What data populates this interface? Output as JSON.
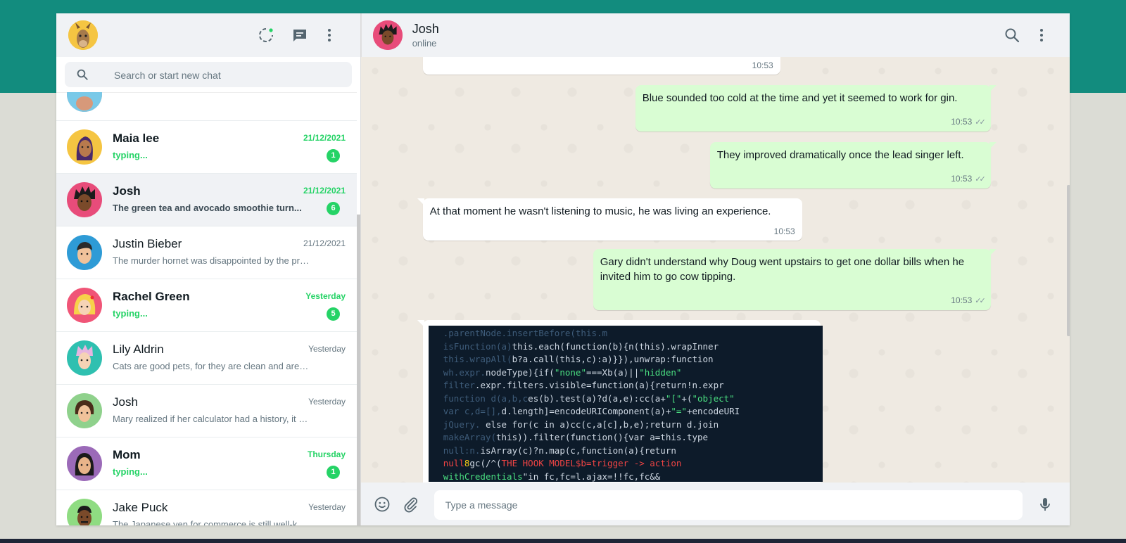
{
  "sidebar": {
    "search_placeholder": "Search or start new chat",
    "chats": [
      {
        "name": "",
        "time": "",
        "preview": "",
        "partial": true
      },
      {
        "name": "Maia lee",
        "time": "21/12/2021",
        "preview": "typing...",
        "unread": "1",
        "bold": true,
        "typing": true,
        "avatar_color": "#f5c542"
      },
      {
        "name": "Josh",
        "time": "21/12/2021",
        "preview": "The green tea and avocado smoothie turn...",
        "unread": "6",
        "bold": true,
        "active": true,
        "avatar_color": "#e84c7a"
      },
      {
        "name": "Justin Bieber",
        "time": "21/12/2021",
        "preview": "The murder hornet was disappointed by the prec...",
        "avatar_color": "#2e9bd6"
      },
      {
        "name": "Rachel Green",
        "time": "Yesterday",
        "preview": "typing...",
        "unread": "5",
        "bold": true,
        "typing": true,
        "avatar_color": "#f05577"
      },
      {
        "name": "Lily Aldrin",
        "time": "Yesterday",
        "preview": "Cats are good pets, for they are clean and are not...",
        "avatar_color": "#2fc0b0"
      },
      {
        "name": "Josh",
        "time": "Yesterday",
        "preview": "Mary realized if her calculator had a history, it wo...",
        "avatar_color": "#8fd18c"
      },
      {
        "name": "Mom",
        "time": "Thursday",
        "preview": "typing...",
        "unread": "1",
        "bold": true,
        "typing": true,
        "avatar_color": "#9b6ab8"
      },
      {
        "name": "Jake Puck",
        "time": "Yesterday",
        "preview": "The Japanese yen for commerce is still well-known.",
        "avatar_color": "#8fdc82"
      }
    ]
  },
  "conversation": {
    "contact_name": "Josh",
    "contact_status": "online",
    "messages": [
      {
        "dir": "in",
        "text": "",
        "time": "10:53"
      },
      {
        "dir": "out",
        "text": "Blue sounded too cold at the time and yet it seemed to work for gin.",
        "time": "10:53"
      },
      {
        "dir": "out",
        "text": "They improved dramatically once the lead singer left.",
        "time": "10:53"
      },
      {
        "dir": "in",
        "text": "At that moment he wasn't listening to music, he was living an experience.",
        "time": "10:53"
      },
      {
        "dir": "out",
        "text": "Gary didn't understand why Doug went upstairs to get one dollar bills when he invited him to go cow tipping.",
        "time": "10:53"
      },
      {
        "dir": "in",
        "type": "image"
      }
    ],
    "input_placeholder": "Type a message"
  },
  "colors": {
    "brand": "#128c7e",
    "unread_badge": "#25d366",
    "outgoing_bubble": "#d9fdd3",
    "incoming_bubble": "#ffffff"
  },
  "icons": {
    "sidebar_header": [
      "status-icon",
      "new-chat-icon",
      "menu-icon"
    ],
    "search": "search-icon",
    "conv_header": [
      "search-icon",
      "menu-icon"
    ],
    "footer": [
      "emoji-icon",
      "attach-icon",
      "mic-icon"
    ]
  }
}
